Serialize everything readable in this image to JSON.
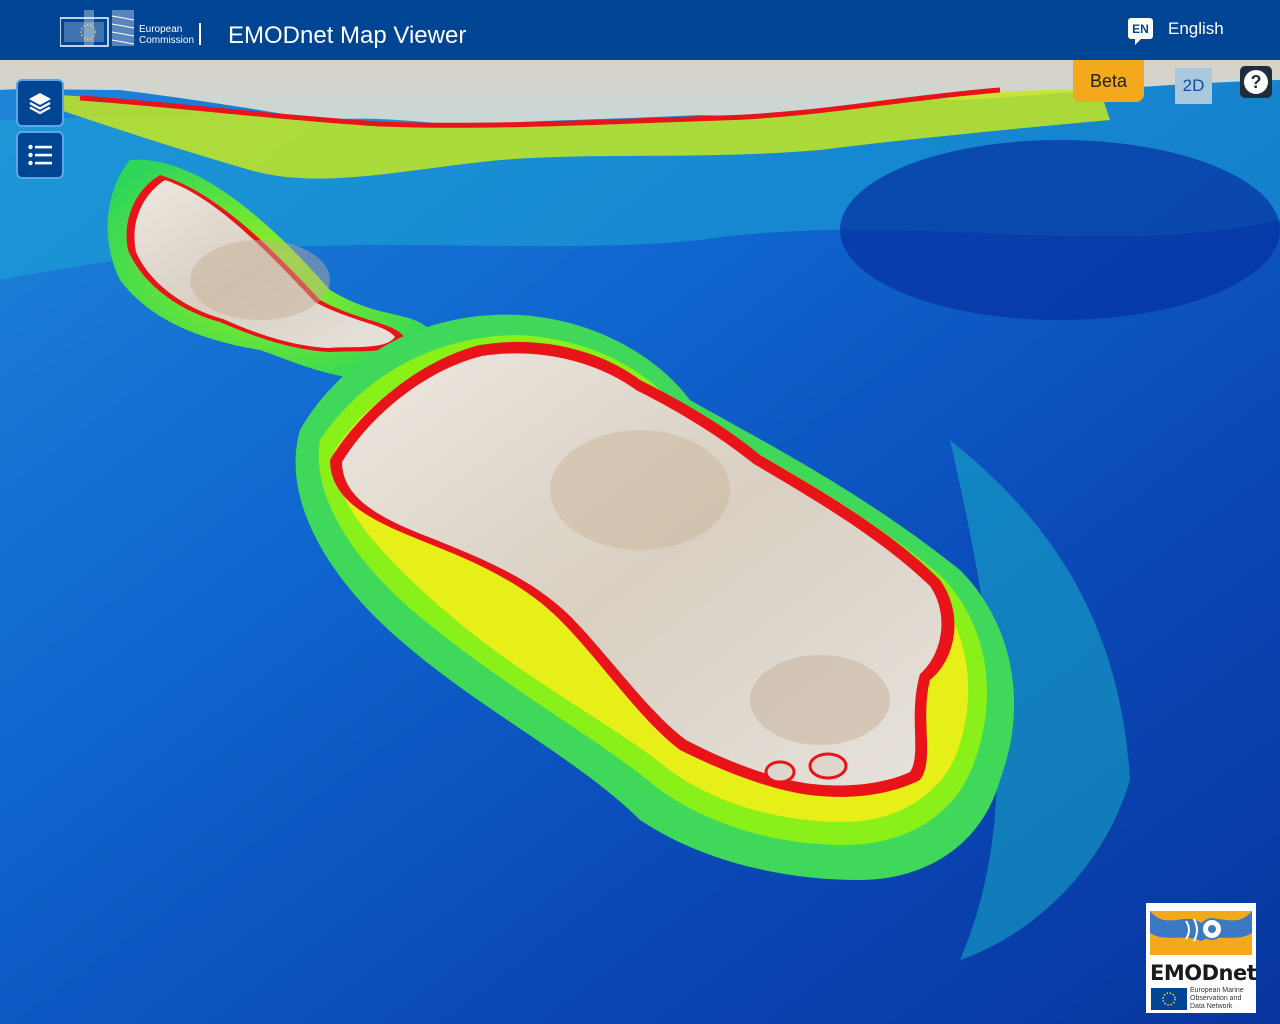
{
  "header": {
    "ec_line1": "European",
    "ec_line2": "Commission",
    "title": "EMODnet Map Viewer",
    "lang_code": "EN",
    "lang_label": "English"
  },
  "controls": {
    "beta_label": "Beta",
    "view_toggle_label": "2D",
    "help_label": "?"
  },
  "sidebar": {
    "layers_icon": "layers-icon",
    "legend_icon": "list-icon"
  },
  "logo": {
    "name": "EMODnet",
    "sub1": "European Marine",
    "sub2": "Observation and",
    "sub3": "Data Network"
  },
  "colors": {
    "header_bg": "#004494",
    "beta_bg": "#f4a81c",
    "deep_sea": "#0a3ea8",
    "shelf_green": "#4fe01a",
    "coast_red": "#e8141a",
    "land": "#e8e4de"
  }
}
